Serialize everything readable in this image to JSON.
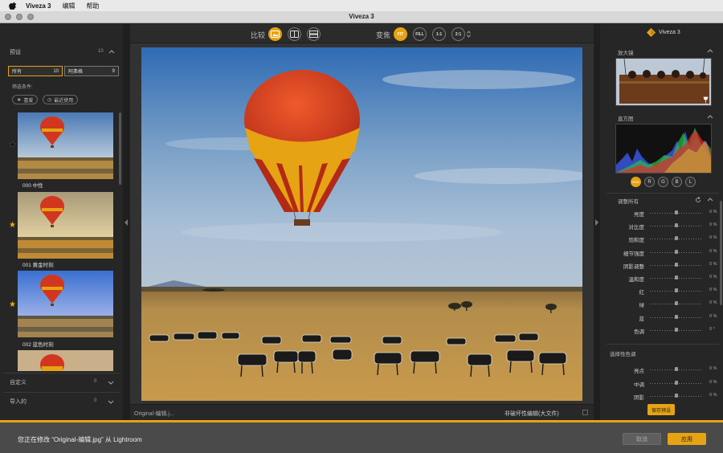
{
  "menubar": {
    "app": "Viveza 3",
    "items": [
      "编辑",
      "帮助"
    ]
  },
  "window": {
    "title": "Viveza 3"
  },
  "presets": {
    "header": "预设",
    "count": "10",
    "filters": [
      {
        "label": "所有",
        "count": "10"
      },
      {
        "label": "阿弗格",
        "count": "9"
      }
    ],
    "filter_label": "筛选条件:",
    "pills": [
      "喜爱",
      "最近使用"
    ],
    "items": [
      {
        "caption": "000 中性"
      },
      {
        "caption": "001 黄金时刻"
      },
      {
        "caption": "002 蓝色时刻"
      }
    ],
    "sections": [
      {
        "label": "自定义",
        "count": "0"
      },
      {
        "label": "导入的",
        "count": "0"
      }
    ]
  },
  "toolbar": {
    "compare_label": "比较",
    "zoom_label": "变焦",
    "zoom_options": [
      "FIT",
      "FILL",
      "1:1",
      "2:1"
    ]
  },
  "status": {
    "filename": "Original-编辑.j...",
    "mode": "非破坏性编辑(大文件)"
  },
  "right": {
    "logo": "Viveza 3",
    "loupe_label": "放大镜",
    "histogram_label": "直方图",
    "channels": [
      "RGB",
      "R",
      "G",
      "B",
      "L"
    ],
    "adjust_label": "调整所有",
    "sliders": [
      {
        "label": "亮度",
        "value": "0 %"
      },
      {
        "label": "对比度",
        "value": "0 %"
      },
      {
        "label": "饱和度",
        "value": "0 %"
      },
      {
        "label": "细节强度",
        "value": "0 %"
      },
      {
        "label": "阴影调整",
        "value": "0 %"
      },
      {
        "label": "温和度",
        "value": "0 %"
      },
      {
        "label": "红",
        "value": "0 %"
      },
      {
        "label": "绿",
        "value": "0 %"
      },
      {
        "label": "蓝",
        "value": "0 %"
      },
      {
        "label": "色调",
        "value": "0 °"
      }
    ],
    "selective_label": "选择性色调",
    "selective": [
      {
        "label": "亮点",
        "value": "0 %"
      },
      {
        "label": "中调",
        "value": "0 %"
      },
      {
        "label": "阴影",
        "value": "0 %"
      }
    ],
    "save_preset": "保存预设"
  },
  "bottom": {
    "message": "您正在修改 “Original-编辑.jpg” 从 Lightroom",
    "cancel": "取消",
    "apply": "应用"
  },
  "colors": {
    "accent": "#e6a313"
  }
}
